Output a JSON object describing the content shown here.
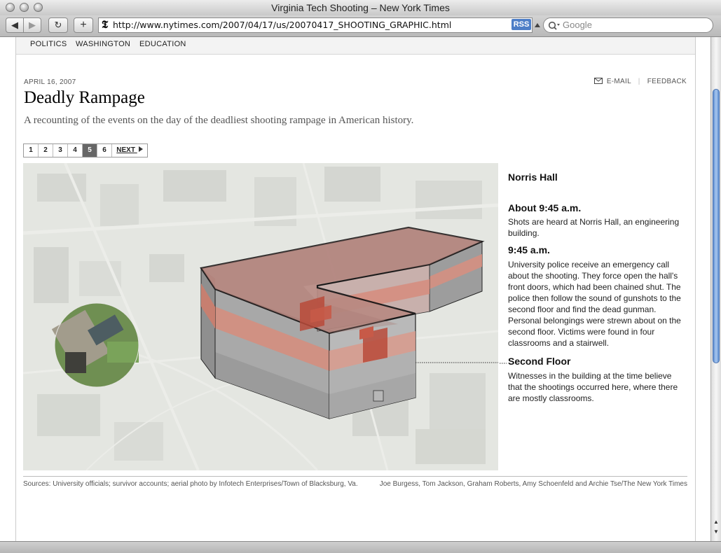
{
  "window": {
    "title": "Virginia Tech Shooting – New York Times"
  },
  "toolbar": {
    "back_label": "◀",
    "forward_label": "▶",
    "reload_label": "↻",
    "add_label": "+",
    "nyt_glyph": "𝕿",
    "url": "http://www.nytimes.com/2007/04/17/us/20070417_SHOOTING_GRAPHIC.html",
    "rss_label": "RSS",
    "search_placeholder": "Google"
  },
  "nav": {
    "items": [
      "POLITICS",
      "WASHINGTON",
      "EDUCATION"
    ]
  },
  "article": {
    "date": "APRIL 16, 2007",
    "email_label": "E-MAIL",
    "feedback_label": "FEEDBACK",
    "headline": "Deadly Rampage",
    "dek": "A recounting of the events on the day of the deadliest shooting rampage in American history."
  },
  "pager": {
    "pages": [
      "1",
      "2",
      "3",
      "4",
      "5",
      "6"
    ],
    "active": "5",
    "next_label": "NEXT"
  },
  "sidebar": {
    "title": "Norris Hall",
    "sections": [
      {
        "head": "About 9:45 a.m.",
        "text": "Shots are heard at Norris Hall, an engineering building."
      },
      {
        "head": "9:45 a.m.",
        "text": "University police receive an emergency call about the shooting. They force open the hall's front doors, which had been chained shut. The police then follow the sound of gunshots to the second floor and find the dead gunman. Personal belongings were strewn about on the second floor. Victims were found in four classrooms and a stairwell."
      },
      {
        "head": "Second Floor",
        "text": "Witnesses in the building at the time believe that the shootings occurred here, where there are mostly classrooms."
      }
    ]
  },
  "credits": {
    "sources": "Sources: University officials; survivor accounts; aerial photo by Infotech Enterprises/Town of Blacksburg, Va.",
    "authors": "Joe Burgess, Tom Jackson, Graham Roberts, Amy Schoenfeld and Archie Tse/The New York Times"
  },
  "colors": {
    "floor_highlight": "#d88878",
    "building_gray": "#9a9a9a",
    "active_page_bg": "#666666"
  }
}
